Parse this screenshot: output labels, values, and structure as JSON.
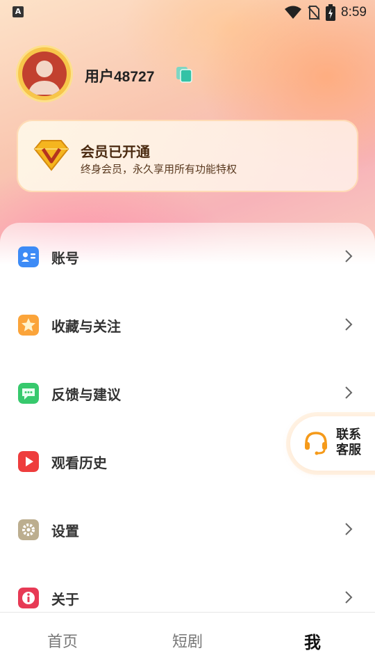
{
  "status_bar": {
    "time": "8:59",
    "left_badge": "A",
    "icons": [
      "wifi-icon",
      "no-sim-icon",
      "battery-charging-icon"
    ]
  },
  "profile": {
    "username": "用户48727",
    "avatar_icon": "avatar-icon",
    "copy_icon": "copy-icon"
  },
  "vip": {
    "badge_letter": "V",
    "title": "会员已开通",
    "subtitle": "终身会员，永久享用所有功能特权"
  },
  "menu": [
    {
      "label": "账号",
      "icon": "account-card-icon",
      "color": "#3d8bf6"
    },
    {
      "label": "收藏与关注",
      "icon": "star-icon",
      "color": "#fba43a"
    },
    {
      "label": "反馈与建议",
      "icon": "chat-bubble-icon",
      "color": "#37c96d"
    },
    {
      "label": "观看历史",
      "icon": "play-icon",
      "color": "#ee3d3d"
    },
    {
      "label": "设置",
      "icon": "gear-icon",
      "color": "#bcae8f"
    },
    {
      "label": "关于",
      "icon": "info-icon",
      "color": "#e73a55"
    }
  ],
  "support": {
    "label": "联系客服",
    "icon": "headset-icon",
    "color": "#f59a1a"
  },
  "tabs": [
    {
      "label": "首页",
      "active": false
    },
    {
      "label": "短剧",
      "active": false
    },
    {
      "label": "我",
      "active": true
    }
  ]
}
